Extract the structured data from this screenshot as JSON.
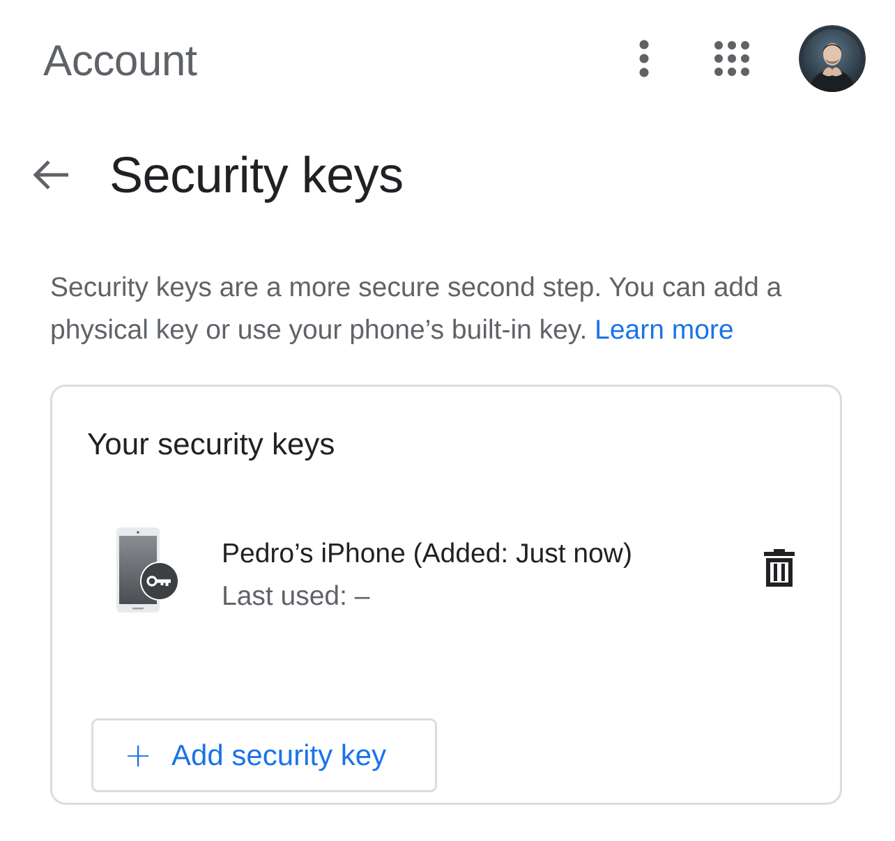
{
  "header": {
    "title": "Account",
    "more_icon": "more-vert-icon",
    "apps_icon": "apps-grid-icon",
    "avatar": "user-avatar"
  },
  "page": {
    "back_icon": "arrow-back-icon",
    "title": "Security keys",
    "description": "Security keys are a more secure second step. You can add a physical key or use your phone’s built-in key.",
    "learn_more": "Learn more"
  },
  "card": {
    "title": "Your security keys",
    "keys": [
      {
        "icon": "phone-key-icon",
        "name": "Pedro’s iPhone (Added: Just now)",
        "last_used": "Last used: –",
        "delete_icon": "trash-icon"
      }
    ],
    "add_button": {
      "icon": "+",
      "label": "Add security key"
    }
  },
  "colors": {
    "accent": "#1a73e8",
    "text_primary": "#202124",
    "text_secondary": "#5f6368",
    "border": "#dadce0"
  }
}
